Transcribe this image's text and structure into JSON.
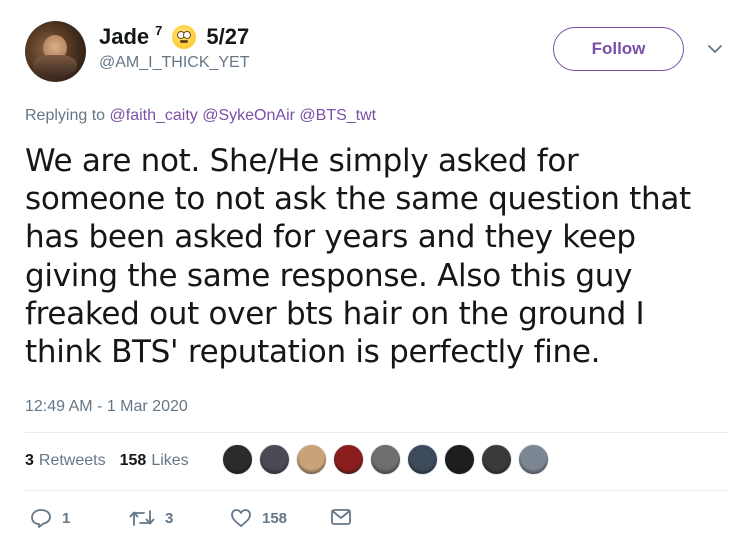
{
  "author": {
    "name": "Jade",
    "superscript": "7",
    "date_tag": "5/27",
    "handle": "@AM_I_THICK_YET"
  },
  "follow_label": "Follow",
  "replying": {
    "prefix": "Replying to",
    "mentions": [
      "@faith_caity",
      "@SykeOnAir",
      "@BTS_twt"
    ]
  },
  "tweet_lines": [
    "We are not. She/He simply asked for",
    "someone to not ask the same question that",
    "has been asked for years and they keep",
    "giving the same response. Also this guy",
    "freaked out over bts hair on the ground I",
    "think BTS' reputation is perfectly fine."
  ],
  "timestamp": "12:49 AM - 1 Mar 2020",
  "stats": {
    "retweets_count": "3",
    "retweets_label": "Retweets",
    "likes_count": "158",
    "likes_label": "Likes"
  },
  "liker_colors": [
    "#2b2b2b",
    "#4a4a55",
    "#c9a27a",
    "#8a1e1e",
    "#6e6e6e",
    "#3d4a5c",
    "#1e1e1e",
    "#3a3a3a",
    "#7d8794"
  ],
  "actions": {
    "reply_count": "1",
    "retweet_count": "3",
    "like_count": "158"
  },
  "colors": {
    "accent": "#7b4fa8",
    "secondary_text": "#657786",
    "primary_text": "#14171a"
  },
  "icons": {
    "reply": "reply-icon",
    "retweet": "retweet-icon",
    "like": "heart-icon",
    "message": "envelope-icon",
    "more": "chevron-down-icon"
  }
}
